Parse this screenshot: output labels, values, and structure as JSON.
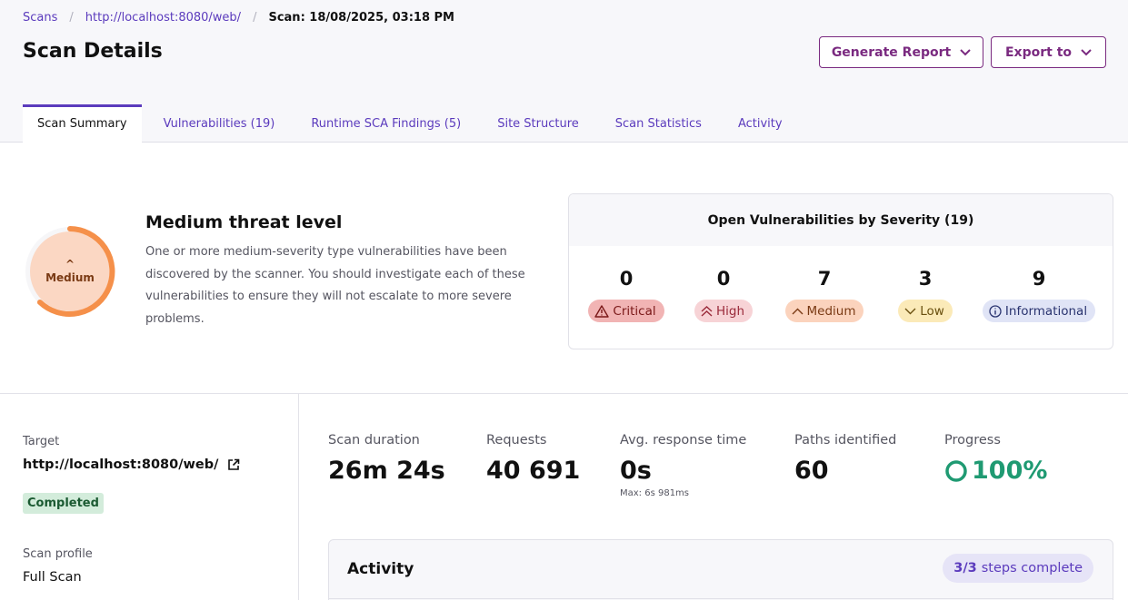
{
  "breadcrumb": {
    "scans": "Scans",
    "site": "http://localhost:8080/web/",
    "current": "Scan: 18/08/2025, 03:18 PM"
  },
  "page_title": "Scan Details",
  "actions": {
    "generate_report": "Generate Report",
    "export": "Export to"
  },
  "tabs": [
    "Scan Summary",
    "Vulnerabilities (19)",
    "Runtime SCA Findings (5)",
    "Site Structure",
    "Scan Statistics",
    "Activity"
  ],
  "active_tab": "Scan Summary",
  "threat": {
    "gauge_label": "Medium",
    "title": "Medium threat level",
    "description": "One or more medium-severity type vulnerabilities have been discovered by the scanner. You should investigate each of these vulnerabilities to ensure they will not escalate to more severe problems."
  },
  "severity_card": {
    "title": "Open Vulnerabilities by Severity (19)",
    "items": [
      {
        "count": "0",
        "label": "Critical",
        "color": "#f1b4b4"
      },
      {
        "count": "0",
        "label": "High",
        "color": "#f7d3d6"
      },
      {
        "count": "7",
        "label": "Medium",
        "color": "#fbd3bd"
      },
      {
        "count": "3",
        "label": "Low",
        "color": "#fbeab8"
      },
      {
        "count": "9",
        "label": "Informational",
        "color": "#e0e4f6"
      }
    ]
  },
  "details": {
    "target_label": "Target",
    "target_value": "http://localhost:8080/web/",
    "status": "Completed",
    "profile_label": "Scan profile",
    "profile_value": "Full Scan"
  },
  "stats": {
    "duration": {
      "label": "Scan duration",
      "value": "26m 24s"
    },
    "requests": {
      "label": "Requests",
      "value": "40 691"
    },
    "response": {
      "label": "Avg. response time",
      "value": "0s",
      "sub": "Max: 6s 981ms"
    },
    "paths": {
      "label": "Paths identified",
      "value": "60"
    },
    "progress": {
      "label": "Progress",
      "value": "100%"
    }
  },
  "activity": {
    "title": "Activity",
    "steps_count": "3/3",
    "steps_text": "steps complete"
  },
  "colors": {
    "accent": "#5b3bbd",
    "brand": "#7a2a80",
    "success": "#1f9a72",
    "medium": "#f5904a"
  }
}
